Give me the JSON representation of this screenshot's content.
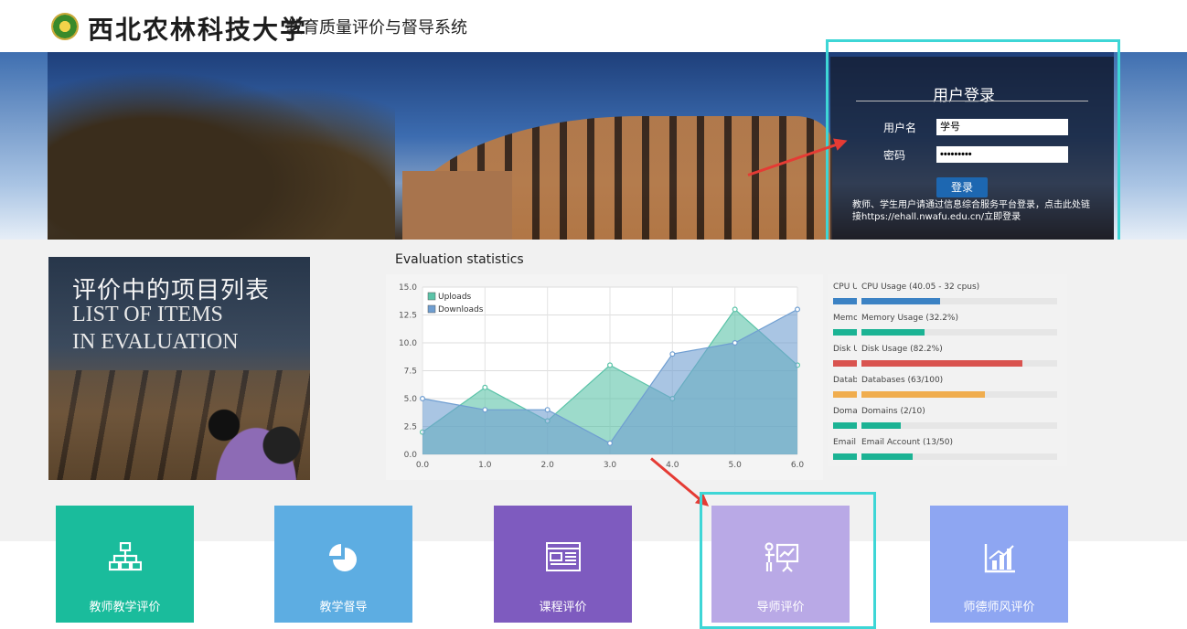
{
  "header": {
    "university": "西北农林科技大学",
    "system": "教育质量评价与督导系统"
  },
  "login": {
    "title": "用户登录",
    "username_label": "用户名",
    "username_value": "学号",
    "password_label": "密码",
    "password_value": "•••••••••",
    "submit_label": "登录",
    "note": "教师、学生用户请通过信息综合服务平台登录，点击此处链接https://ehall.nwafu.edu.cn/立即登录"
  },
  "list_panel": {
    "title_cn": "评价中的项目列表",
    "title_en_1": "LIST OF ITEMS",
    "title_en_2": "IN EVALUATION"
  },
  "chart_data": {
    "type": "area",
    "title": "Evaluation statistics",
    "x": [
      0,
      1,
      2,
      3,
      4,
      5,
      6
    ],
    "x_ticks": [
      "0.0",
      "1.0",
      "2.0",
      "3.0",
      "4.0",
      "5.0",
      "6.0"
    ],
    "y_ticks": [
      "0.0",
      "2.5",
      "5.0",
      "7.5",
      "10.0",
      "12.5",
      "15.0"
    ],
    "xlim": [
      0,
      6
    ],
    "ylim": [
      0,
      15
    ],
    "grid": true,
    "legend": "top-left",
    "series": [
      {
        "name": "Uploads",
        "color": "#5bc3a8",
        "values": [
          2,
          6,
          3,
          8,
          5,
          13,
          8
        ]
      },
      {
        "name": "Downloads",
        "color": "#6f9ed1",
        "values": [
          5,
          4,
          4,
          1,
          9,
          10,
          13
        ]
      }
    ]
  },
  "usage": [
    {
      "short": "CPU Usage (40.05 - 32 cpus)",
      "label": "CPU Usage (40.05 - 32 cpus)",
      "percent": 40.05,
      "color": "#3b82c4"
    },
    {
      "short": "Memory Usage (32.2%)",
      "label": "Memory Usage (32.2%)",
      "percent": 32.2,
      "color": "#1bb394"
    },
    {
      "short": "Disk Usage (82.2%)",
      "label": "Disk Usage (82.2%)",
      "percent": 82.2,
      "color": "#d9534f"
    },
    {
      "short": "Databases (63/100)",
      "label": "Databases (63/100)",
      "percent": 63,
      "color": "#f0ad4e"
    },
    {
      "short": "Domains (2/10)",
      "label": "Domains (2/10)",
      "percent": 20,
      "color": "#1bb394"
    },
    {
      "short": "Email Account (13/50)",
      "label": "Email Account (13/50)",
      "percent": 26,
      "color": "#1bb394"
    }
  ],
  "tiles": [
    {
      "label": "教师教学评价",
      "icon": "sitemap-icon",
      "color": "#1abc9c"
    },
    {
      "label": "教学督导",
      "icon": "pie-chart-icon",
      "color": "#5dade2"
    },
    {
      "label": "课程评价",
      "icon": "web-layout-icon",
      "color": "#7e5bbf"
    },
    {
      "label": "导师评价",
      "icon": "presentation-icon",
      "color": "#b9a9e6"
    },
    {
      "label": "师德师风评价",
      "icon": "bar-chart-icon",
      "color": "#8ea6f2"
    }
  ]
}
